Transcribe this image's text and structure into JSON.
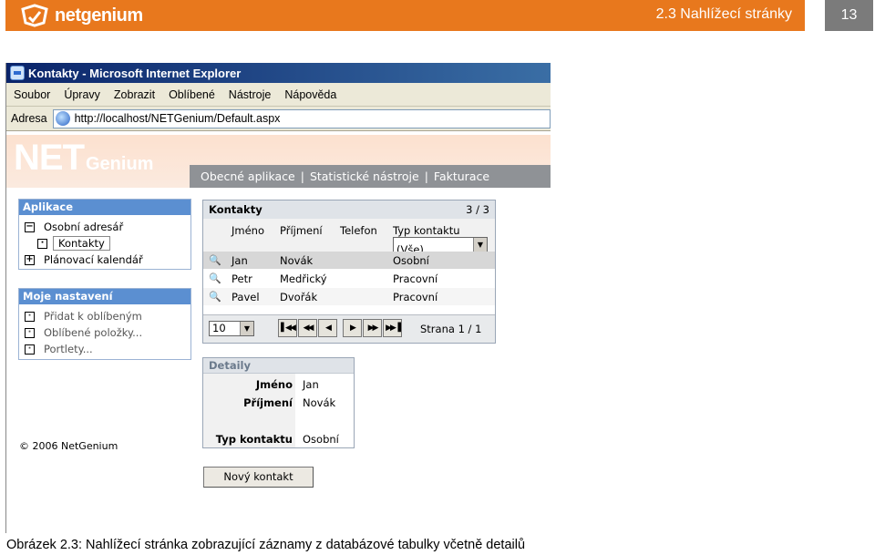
{
  "doc": {
    "logo_text": "netgenium",
    "header_title": "2.3 Nahlížecí stránky",
    "page_number": "13",
    "caption": "Obrázek 2.3: Nahlížecí stránka zobrazující záznamy z databázové tabulky včetně detailů"
  },
  "browser": {
    "title": "Kontakty - Microsoft Internet Explorer",
    "menu": [
      "Soubor",
      "Úpravy",
      "Zobrazit",
      "Oblíbené",
      "Nástroje",
      "Nápověda"
    ],
    "address_label": "Adresa",
    "url": "http://localhost/NETGenium/Default.aspx"
  },
  "app": {
    "brand_net": "NET",
    "brand_genium": "Genium",
    "topnav": [
      "Obecné aplikace",
      "Statistické nástroje",
      "Fakturace"
    ],
    "sidebar": {
      "apps_title": "Aplikace",
      "apps_items": [
        {
          "label": "Osobní adresář",
          "box": "−"
        },
        {
          "label": "Kontakty",
          "box": "·"
        },
        {
          "label": "Plánovací kalendář",
          "box": "+"
        }
      ],
      "settings_title": "Moje nastavení",
      "settings_items": [
        "Přidat k oblíbeným",
        "Oblíbené položky...",
        "Portlety..."
      ]
    },
    "copyright": "© 2006 NetGenium",
    "grid": {
      "title": "Kontakty",
      "count": "3 / 3",
      "columns": [
        "Jméno",
        "Příjmení",
        "Telefon",
        "Typ kontaktu"
      ],
      "filter_value": "(Vše)",
      "rows": [
        {
          "jmeno": "Jan",
          "prijmeni": "Novák",
          "telefon": "",
          "typ": "Osobní"
        },
        {
          "jmeno": "Petr",
          "prijmeni": "Medřický",
          "telefon": "",
          "typ": "Pracovní"
        },
        {
          "jmeno": "Pavel",
          "prijmeni": "Dvořák",
          "telefon": "",
          "typ": "Pracovní"
        }
      ],
      "page_size": "10",
      "page_status": "Strana 1 / 1"
    },
    "detail": {
      "title": "Detaily",
      "fields": [
        {
          "label": "Jméno",
          "value": "Jan"
        },
        {
          "label": "Příjmení",
          "value": "Novák"
        },
        {
          "label": "Typ kontaktu",
          "value": "Osobní"
        }
      ]
    },
    "new_button": "Nový kontakt"
  }
}
